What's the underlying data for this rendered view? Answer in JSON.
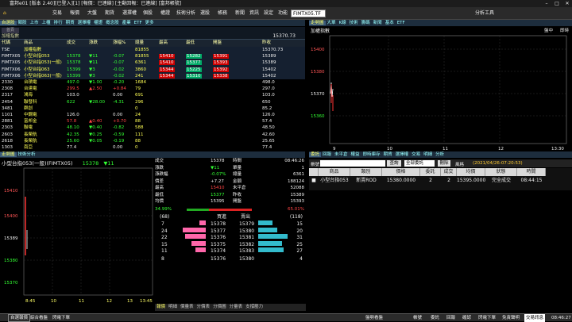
{
  "window": {
    "title": "富邦e01 [版本 2.40][已登入][1] [報價：已連線] [主動回報：已連線] [富邦帳號]"
  },
  "menu": {
    "items": [
      "交易",
      "報價",
      "大盤",
      "期貨",
      "選擇權",
      "個股",
      "權證",
      "技術分析",
      "選股",
      "帳務",
      "新聞",
      "資訊",
      "設定",
      "功能"
    ],
    "code_input": "FIMTX05.TF",
    "right_btn": "分析工具"
  },
  "quote": {
    "header_left": "首頁",
    "header_name": "加權指數",
    "header_value": "15370.73",
    "columns": [
      "代碼",
      "商品",
      "成交",
      "漲跌",
      "漲幅%",
      "總量",
      "最高",
      "最低",
      "開盤",
      "昨收"
    ],
    "rows": [
      {
        "code": "TSE",
        "name": "加權指數",
        "last": "",
        "chg": "",
        "pct": "",
        "vol": "81855",
        "hi": "",
        "lo": "",
        "open": "",
        "prev": "15370.73"
      },
      {
        "code": "FIMTX05",
        "name": "小型台指053",
        "last": "15378",
        "chg": "▼11",
        "pct": "-0.07",
        "vol": "81855",
        "hi": "15410",
        "lo": "15282",
        "open": "15391",
        "prev": "15389"
      },
      {
        "code": "FIMTX05",
        "name": "小型台指053(一般)",
        "last": "15378",
        "chg": "▼11",
        "pct": "-0.07",
        "vol": "6361",
        "hi": "15410",
        "lo": "15377",
        "open": "15393",
        "prev": "15389"
      },
      {
        "code": "FIMTX06",
        "name": "小型台指063",
        "last": "15399",
        "chg": "▼3",
        "pct": "-0.02",
        "vol": "3860",
        "hi": "15344",
        "lo": "15225",
        "open": "15392",
        "prev": "15402"
      },
      {
        "code": "FIMTX06",
        "name": "小型台指063(一般)",
        "last": "15399",
        "chg": "▼3",
        "pct": "-0.02",
        "vol": "241",
        "hi": "15344",
        "lo": "15310",
        "open": "15338",
        "prev": "15402"
      },
      {
        "code": "2330",
        "name": "台積電",
        "last": "497.0",
        "chg": "▼1.00",
        "pct": "-0.20",
        "vol": "1684",
        "hi": "",
        "lo": "",
        "open": "",
        "prev": "498.0"
      },
      {
        "code": "2308",
        "name": "台達電",
        "last": "299.5",
        "chg": "▲2.50",
        "pct": "+0.84",
        "vol": "79",
        "hi": "",
        "lo": "",
        "open": "",
        "prev": "297.0"
      },
      {
        "code": "2317",
        "name": "鴻海",
        "last": "103.0",
        "chg": "",
        "pct": "0.00",
        "vol": "691",
        "hi": "",
        "lo": "",
        "open": "",
        "prev": "103.0"
      },
      {
        "code": "2454",
        "name": "聯發科",
        "last": "622",
        "chg": "▼28.00",
        "pct": "-4.31",
        "vol": "296",
        "hi": "",
        "lo": "",
        "open": "",
        "prev": "650"
      },
      {
        "code": "3481",
        "name": "群創",
        "last": "",
        "chg": "",
        "pct": "",
        "vol": "0",
        "hi": "",
        "lo": "",
        "open": "",
        "prev": "85.2"
      },
      {
        "code": "1101",
        "name": "中鋼電",
        "last": "126.0",
        "chg": "",
        "pct": "0.00",
        "vol": "24",
        "hi": "",
        "lo": "",
        "open": "",
        "prev": "126.0"
      },
      {
        "code": "2881",
        "name": "富邦金",
        "last": "57.8",
        "chg": "▲0.40",
        "pct": "+0.70",
        "vol": "88",
        "hi": "",
        "lo": "",
        "open": "",
        "prev": "57.4"
      },
      {
        "code": "2303",
        "name": "聯電",
        "last": "48.10",
        "chg": "▼0.40",
        "pct": "-0.82",
        "vol": "588",
        "hi": "",
        "lo": "",
        "open": "",
        "prev": "48.50"
      },
      {
        "code": "2603",
        "name": "長榮航",
        "last": "42.35",
        "chg": "▼0.25",
        "pct": "-0.59",
        "vol": "111",
        "hi": "",
        "lo": "",
        "open": "",
        "prev": "42.60"
      },
      {
        "code": "2618",
        "name": "長榮航",
        "last": "25.60",
        "chg": "▼0.05",
        "pct": "-0.19",
        "vol": "88",
        "hi": "",
        "lo": "",
        "open": "",
        "prev": "25.65"
      },
      {
        "code": "1303",
        "name": "南亞",
        "last": "77.4",
        "chg": "",
        "pct": "0.00",
        "vol": "0",
        "hi": "",
        "lo": "",
        "open": "",
        "prev": "77.4"
      },
      {
        "code": "2891",
        "name": "中信金",
        "last": "91.6",
        "chg": "▼0.40",
        "pct": "-0.43",
        "vol": "0",
        "hi": "",
        "lo": "",
        "open": "",
        "prev": "91.6"
      },
      {
        "code": "2002",
        "name": "中鋼",
        "last": "29.75",
        "chg": "",
        "pct": "0.00",
        "vol": "0",
        "hi": "",
        "lo": "",
        "open": "",
        "prev": "29.75"
      }
    ]
  },
  "topright": {
    "title": "加權指數",
    "labels": [
      "盤中",
      "即時"
    ],
    "y_ticks": [
      "15400",
      "15380",
      "15370",
      "15360"
    ],
    "x_ticks": [
      "9",
      "10",
      "11",
      "12",
      "13:30"
    ]
  },
  "ticker": {
    "name": "小型台指053(一般)(FIMTX05)",
    "price": "15378",
    "chg": "▼11"
  },
  "kline": {
    "y_ticks": [
      "15410",
      "15400",
      "15389",
      "15380",
      "15370"
    ],
    "x_ticks": [
      "8:45",
      "10",
      "11",
      "12",
      "13",
      "13:45"
    ]
  },
  "detail": {
    "rows": [
      {
        "k1": "成交",
        "v1": "15378",
        "k2": "時間",
        "v2": "08:46:26"
      },
      {
        "k1": "漲跌",
        "v1": "▼11",
        "k2": "單量",
        "v2": "1"
      },
      {
        "k1": "漲跌幅",
        "v1": "-0.07%",
        "k2": "總量",
        "v2": "6361"
      },
      {
        "k1": "價差",
        "v1": "+7.27",
        "k2": "金額",
        "v2": "188124"
      },
      {
        "k1": "最高",
        "v1": "15410",
        "k2": "未平倉",
        "v2": "52088"
      },
      {
        "k1": "最低",
        "v1": "15377",
        "k2": "昨收",
        "v2": "15389"
      },
      {
        "k1": "均價",
        "v1": "15395",
        "k2": "開盤",
        "v2": "15393"
      }
    ],
    "ratio_left": "34.99%",
    "ratio_right": "65.01%"
  },
  "book": {
    "total_buy": "(68)",
    "total_sell": "(118)",
    "head_buy": "買進",
    "head_sell": "賣出",
    "rows": [
      {
        "bq": "7",
        "bp": "15378",
        "sp": "15379",
        "sq": "15"
      },
      {
        "bq": "24",
        "bp": "15377",
        "sp": "15380",
        "sq": "20"
      },
      {
        "bq": "22",
        "bp": "15376",
        "sp": "15381",
        "sq": "31"
      },
      {
        "bq": "15",
        "bp": "15375",
        "sp": "15382",
        "sq": "25"
      },
      {
        "bq": "11",
        "bp": "15374",
        "sp": "15383",
        "sq": "27"
      }
    ],
    "foot": {
      "left": "8",
      "p1": "15376",
      "p2": "15380",
      "right": "4"
    }
  },
  "bottom_tabs": [
    "報價",
    "明細",
    "價量表",
    "分價表",
    "分價圖",
    "分量表",
    "支撐壓力"
  ],
  "orders": {
    "tabs": [
      "委託",
      "回報",
      "未平倉",
      "權益",
      "即時庫存",
      "期貨",
      "選擇權",
      "交易",
      "明細",
      "分析"
    ],
    "account_label": "帳號",
    "query_btn": "查詢",
    "filter": "全部委託",
    "cancel_btn": "刪除",
    "refresh_label": "風格",
    "updated": "(2021/04/26-07:20:53)",
    "columns": [
      "",
      "商品",
      "類別",
      "價格",
      "委託",
      "成交",
      "均價",
      "狀態",
      "時間"
    ],
    "rows": [
      {
        "sel": "■",
        "product": "小型台指053",
        "type": "新賣ROD",
        "price": "15380.0000",
        "ord": "2",
        "fill": "2",
        "avg": "15395.0000",
        "status": "完全成交",
        "time": "08:44:15"
      }
    ]
  },
  "status": {
    "items": [
      "自選報價",
      "綜合看盤",
      "閃電下單"
    ],
    "right": [
      "帳號",
      "委託",
      "回報",
      "確認",
      "閃電下單",
      "免責聲明",
      "交易訊息",
      "08:46:27"
    ],
    "right2": "盤勢看盤"
  }
}
